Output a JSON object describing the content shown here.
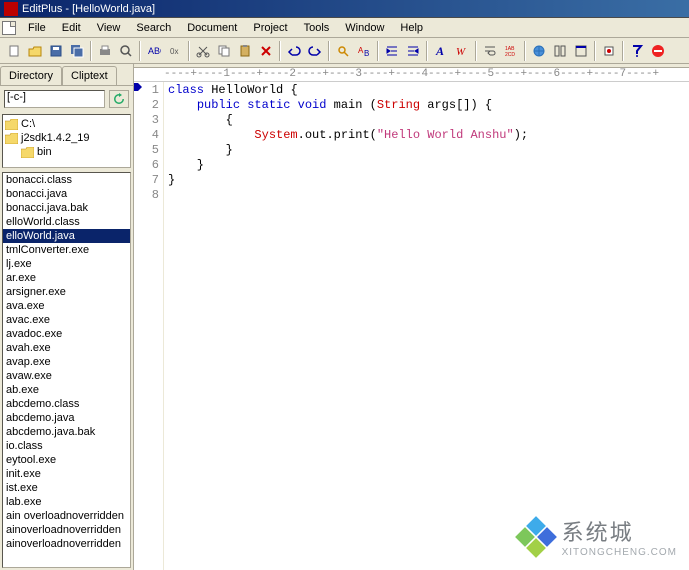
{
  "title": "EditPlus - [HelloWorld.java]",
  "menu": [
    "File",
    "Edit",
    "View",
    "Search",
    "Document",
    "Project",
    "Tools",
    "Window",
    "Help"
  ],
  "toolbar_icons": [
    "new",
    "open",
    "save",
    "save-all",
    "print",
    "preview",
    "spell",
    "hex",
    "cut",
    "copy",
    "paste",
    "delete",
    "undo",
    "redo",
    "find",
    "replace",
    "indent",
    "outdent",
    "bold",
    "font",
    "wordwrap",
    "line-num",
    "browser",
    "columns",
    "full",
    "pref",
    "help",
    "stop"
  ],
  "sidebar": {
    "tabs": [
      "Directory",
      "Cliptext"
    ],
    "active_tab": 0,
    "drive": "[-c-]",
    "tree": [
      {
        "label": "C:\\",
        "indent": 0
      },
      {
        "label": "j2sdk1.4.2_19",
        "indent": 0
      },
      {
        "label": "bin",
        "indent": 1
      }
    ],
    "files": [
      "bonacci.class",
      "bonacci.java",
      "bonacci.java.bak",
      "elloWorld.class",
      "elloWorld.java",
      "tmlConverter.exe",
      "lj.exe",
      "ar.exe",
      "arsigner.exe",
      "ava.exe",
      "avac.exe",
      "avadoc.exe",
      "avah.exe",
      "avap.exe",
      "avaw.exe",
      "ab.exe",
      "abcdemo.class",
      "abcdemo.java",
      "abcdemo.java.bak",
      "io.class",
      "eytool.exe",
      "init.exe",
      "ist.exe",
      "lab.exe",
      "ain overloadnoverridden",
      "ainoverloadnoverridden",
      "ainoverloadnoverridden"
    ],
    "selected_file_index": 4
  },
  "ruler": "----+----1----+----2----+----3----+----4----+----5----+----6----+----7----+",
  "code": {
    "lines": [
      1,
      2,
      3,
      4,
      5,
      6,
      7,
      8
    ],
    "tokens": [
      [
        {
          "t": "class ",
          "c": "kw"
        },
        {
          "t": "HelloWorld ",
          "c": "pln"
        },
        {
          "t": "{",
          "c": "pln"
        }
      ],
      [
        {
          "t": "    ",
          "c": "pln"
        },
        {
          "t": "public static void ",
          "c": "kw"
        },
        {
          "t": "main ",
          "c": "pln"
        },
        {
          "t": "(",
          "c": "pln"
        },
        {
          "t": "String ",
          "c": "cls"
        },
        {
          "t": "args",
          "c": "pln"
        },
        {
          "t": "[]) {",
          "c": "pln"
        }
      ],
      [
        {
          "t": "        {",
          "c": "pln"
        }
      ],
      [
        {
          "t": "            ",
          "c": "pln"
        },
        {
          "t": "System",
          "c": "cls"
        },
        {
          "t": ".out.print(",
          "c": "pln"
        },
        {
          "t": "\"Hello World Anshu\"",
          "c": "str"
        },
        {
          "t": ");",
          "c": "pln"
        }
      ],
      [
        {
          "t": "        }",
          "c": "pln"
        }
      ],
      [
        {
          "t": "    }",
          "c": "pln"
        }
      ],
      [
        {
          "t": "}",
          "c": "pln"
        }
      ],
      [
        {
          "t": "",
          "c": "pln"
        }
      ]
    ]
  },
  "watermark": {
    "title": "系统城",
    "sub": "XITONGCHENG.COM"
  }
}
